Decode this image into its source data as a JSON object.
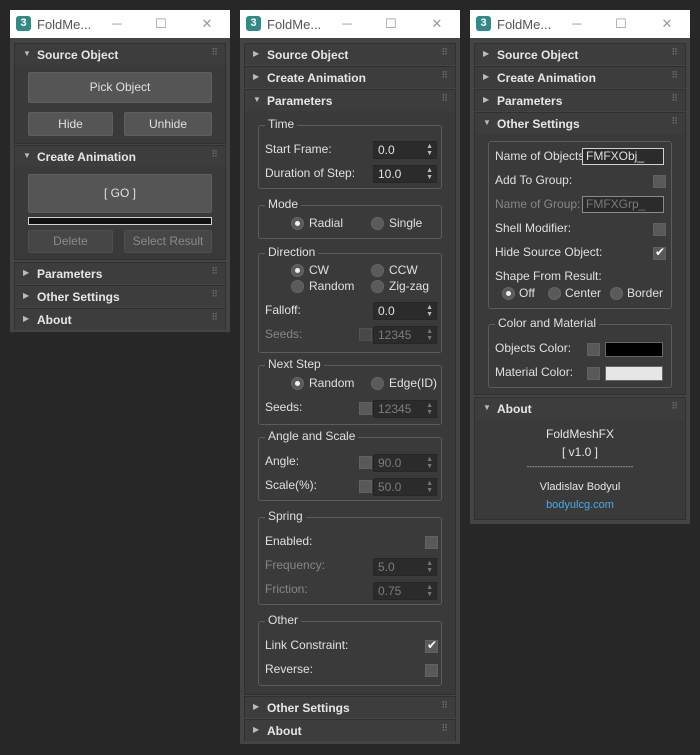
{
  "windows": [
    {
      "title": "FoldMe..."
    },
    {
      "title": "FoldMe..."
    },
    {
      "title": "FoldMe..."
    }
  ],
  "rollouts": {
    "source_object": "Source Object",
    "create_animation": "Create Animation",
    "parameters": "Parameters",
    "other_settings": "Other Settings",
    "about": "About"
  },
  "source_object": {
    "pick_label": "Pick Object",
    "hide_label": "Hide",
    "unhide_label": "Unhide"
  },
  "create_animation": {
    "go_label": "[ GO ]",
    "progress": 0,
    "delete_label": "Delete",
    "select_result_label": "Select Result"
  },
  "parameters": {
    "time": {
      "title": "Time",
      "start_frame_label": "Start Frame:",
      "start_frame": "0.0",
      "duration_label": "Duration of Step:",
      "duration": "10.0"
    },
    "mode": {
      "title": "Mode",
      "radial": "Radial",
      "single": "Single",
      "selected": "Radial"
    },
    "direction": {
      "title": "Direction",
      "cw": "CW",
      "ccw": "CCW",
      "random": "Random",
      "zigzag": "Zig-zag",
      "selected": "CW",
      "falloff_label": "Falloff:",
      "falloff": "0.0",
      "seeds_label": "Seeds:",
      "seeds": "12345"
    },
    "next_step": {
      "title": "Next Step",
      "random": "Random",
      "edge": "Edge(ID)",
      "selected": "Random",
      "seeds_label": "Seeds:",
      "seeds": "12345"
    },
    "angle_scale": {
      "title": "Angle and Scale",
      "angle_label": "Angle:",
      "angle": "90.0",
      "scale_label": "Scale(%):",
      "scale": "50.0"
    },
    "spring": {
      "title": "Spring",
      "enabled_label": "Enabled:",
      "frequency_label": "Frequency:",
      "frequency": "5.0",
      "friction_label": "Friction:",
      "friction": "0.75"
    },
    "other": {
      "title": "Other",
      "link_constraint_label": "Link Constraint:",
      "link_constraint": true,
      "reverse_label": "Reverse:",
      "reverse": false
    }
  },
  "other_settings": {
    "name_of_objects_label": "Name of Objects:",
    "name_of_objects": "FMFXObj_",
    "add_to_group_label": "Add To Group:",
    "name_of_group_label": "Name of Group:",
    "name_of_group": "FMFXGrp_",
    "shell_modifier_label": "Shell Modifier:",
    "hide_source_label": "Hide Source Object:",
    "hide_source": true,
    "shape_from_result_label": "Shape From Result:",
    "shape_off": "Off",
    "shape_center": "Center",
    "shape_border": "Border",
    "shape_selected": "Off",
    "color_material": {
      "title": "Color and Material",
      "objects_color_label": "Objects Color:",
      "objects_color": "#000000",
      "material_color_label": "Material Color:",
      "material_color": "#e6e6e6"
    }
  },
  "about": {
    "product": "FoldMeshFX",
    "version": "[ v1.0 ]",
    "divider": "----------------------------------------",
    "author": "Vladislav Bodyul",
    "link": "bodyulcg.com",
    "link_color": "#4aa8e8"
  },
  "colors": {
    "panel_bg": "#444444",
    "rollout_bg": "#3a3a3a",
    "text": "#dcdcdc"
  }
}
